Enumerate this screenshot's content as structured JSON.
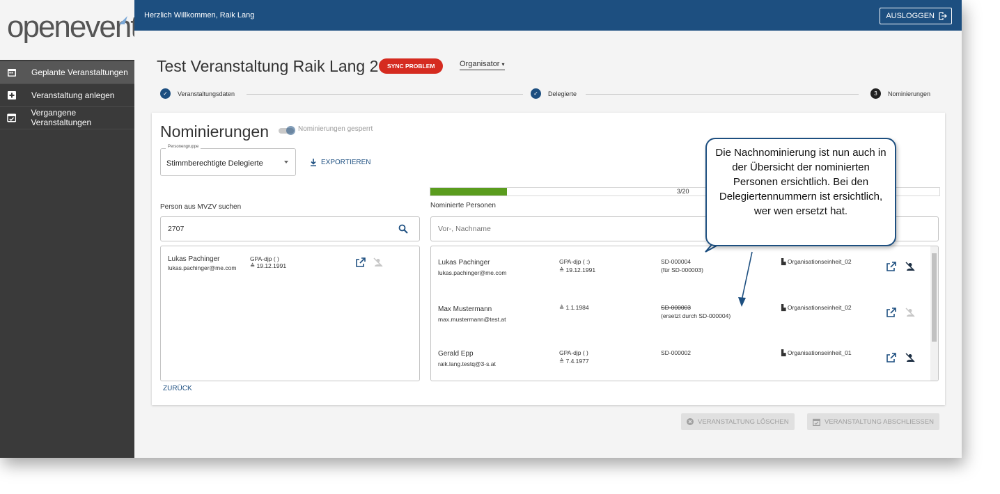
{
  "app": {
    "logo": "openevents"
  },
  "sidebar": {
    "items": [
      {
        "label": "Geplante Veranstaltungen",
        "icon": "calendar-icon",
        "active": true
      },
      {
        "label": "Veranstaltung anlegen",
        "icon": "plus-box-icon",
        "active": false
      },
      {
        "label": "Vergangene Veranstaltungen",
        "icon": "calendar-check-icon",
        "active": false
      }
    ]
  },
  "header": {
    "welcome": "Herzlich Willkommen, Raik Lang",
    "logout_label": "AUSLOGGEN"
  },
  "event": {
    "title": "Test Veranstaltung Raik Lang 2",
    "badge": "SYNC PROBLEM",
    "role": "Organisator"
  },
  "stepper": {
    "steps": [
      {
        "label": "Veranstaltungsdaten",
        "state": "done"
      },
      {
        "label": "Delegierte",
        "state": "done"
      },
      {
        "label": "Nominierungen",
        "state": "current",
        "number": "3"
      }
    ]
  },
  "nominations": {
    "title": "Nominierungen",
    "lock_label": "Nominierungen gesperrt",
    "group_legend": "Personengruppe",
    "group_value": "Stimmberechtigte Delegierte",
    "export_label": "EXPORTIEREN",
    "progress": {
      "text": "3/20",
      "fraction": 0.15
    },
    "search_label": "Person aus MVZV suchen",
    "search_value": "2707",
    "nominated_label": "Nominierte Personen",
    "filter_placeholder": "Vor-, Nachname",
    "back_label": "ZURÜCK"
  },
  "search_results": [
    {
      "name": "Lukas Pachinger",
      "email": "lukas.pachinger@me.com",
      "union": "GPA-djp (              )",
      "birth": "19.12.1991"
    }
  ],
  "nominated": [
    {
      "name": "Lukas Pachinger",
      "email": "lukas.pachinger@me.com",
      "union": "GPA-djp (              :)",
      "birth": "19.12.1991",
      "delegate_no": "SD-000004",
      "delegate_note": "(für SD-000003)",
      "struck": false,
      "unit": "Organisationseinheit_02",
      "remove_enabled": true
    },
    {
      "name": "Max Mustermann",
      "email": "max.mustermann@test.at",
      "union": "",
      "birth": "1.1.1984",
      "delegate_no": "SD-000003",
      "delegate_note": "(ersetzt durch SD-000004)",
      "struck": true,
      "unit": "Organisationseinheit_02",
      "remove_enabled": false
    },
    {
      "name": "Gerald Epp",
      "email": "raik.lang.testq@3-s.at",
      "union": "GPA-djp (              )",
      "birth": "7.4.1977",
      "delegate_no": "SD-000002",
      "delegate_note": "",
      "struck": false,
      "unit": "Organisationseinheit_01",
      "remove_enabled": true
    }
  ],
  "footer_buttons": {
    "delete_label": "VERANSTALTUNG LÖSCHEN",
    "close_label": "VERANSTALTUNG ABSCHLIESSEN"
  },
  "callout": {
    "text": "Die Nachnominierung ist nun auch in der Übersicht der nominierten Personen ersichtlich. Bei den Delegiertennummern ist ersichtlich, wer wen ersetzt hat."
  },
  "colors": {
    "primary": "#1d4f80",
    "danger": "#d52b20",
    "progress": "#5a9c1e",
    "sidebar": "#3a3a3a"
  }
}
